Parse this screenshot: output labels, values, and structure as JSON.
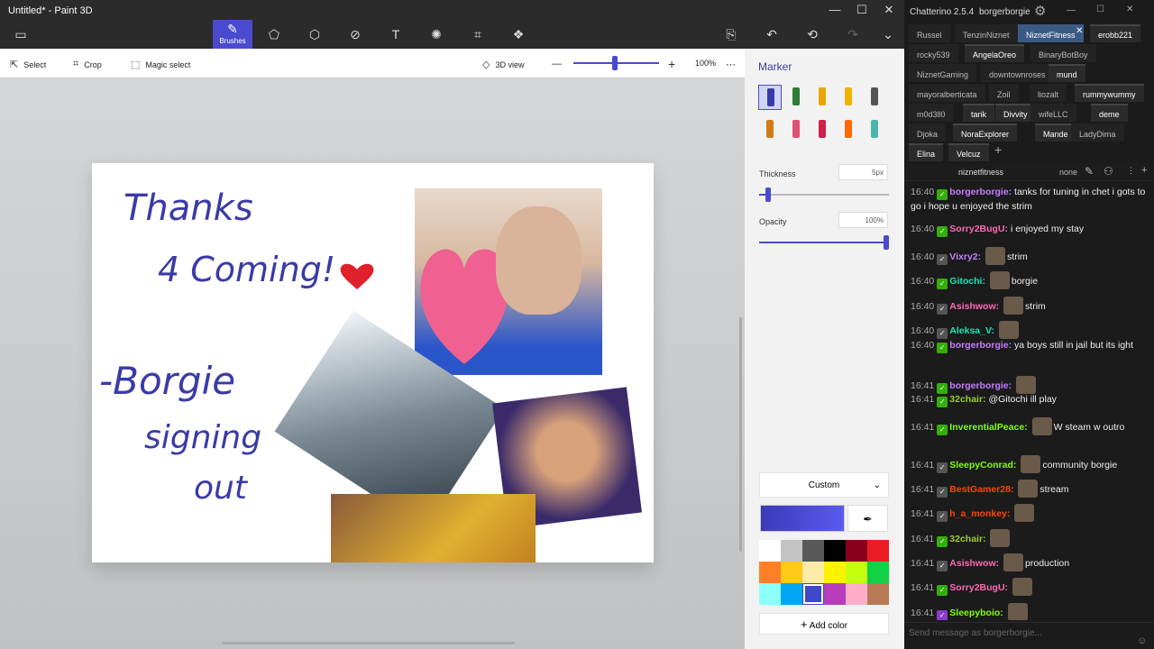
{
  "paint": {
    "title": "Untitled* - Paint 3D",
    "ribbon": {
      "brushes_label": "Brushes"
    },
    "toolbar": {
      "select": "Select",
      "crop": "Crop",
      "magic_select": "Magic select",
      "view3d": "3D view",
      "zoom": "100%"
    },
    "canvas": {
      "line1": "Thanks",
      "line2": "4 Coming!",
      "line3": "-Borgie",
      "line4": "signing",
      "line5": "out"
    },
    "panel": {
      "heading": "Marker",
      "thickness_label": "Thickness",
      "thickness_value": "5px",
      "thickness_level": 0.05,
      "opacity_label": "Opacity",
      "opacity_value": "100%",
      "opacity_level": 1.0,
      "color_mode": "Custom",
      "add_color": "Add color",
      "current_color": "#4444cc",
      "palette": [
        "#ffffff",
        "#c3c3c3",
        "#585858",
        "#000000",
        "#88001b",
        "#ec1c24",
        "#ff7f27",
        "#ffca18",
        "#fdeca6",
        "#fff200",
        "#c4ff0e",
        "#0ed145",
        "#8cfffb",
        "#00a8f3",
        "#3f48cc",
        "#b83dba",
        "#ffaec8",
        "#b97a56"
      ],
      "brush_icons": [
        "marker-icon",
        "calligraphy-pen-icon",
        "oil-brush-icon",
        "watercolor-icon",
        "pixel-pen-icon",
        "pencil-icon",
        "eraser-icon",
        "crayon-icon",
        "spray-can-icon",
        "fill-icon"
      ]
    }
  },
  "chat": {
    "app": "Chatterino 2.5.4",
    "account": "borgerborgie",
    "tabs_row1": [
      "Russel",
      "TenzinNiznet",
      "NiznetFitness",
      "erobb221"
    ],
    "tabs_row2": [
      "rocky539",
      "AngelaOreo",
      "BinaryBotBoy"
    ],
    "tabs_row3": [
      "NiznetGaming",
      "downtownroses",
      "mund"
    ],
    "tabs_row4": [
      "mayoralberticata",
      "Zoil",
      "liozalt",
      "rummywummy"
    ],
    "tabs_row5": [
      "m0d3ll0",
      "tarik",
      "Divvity",
      "wifeLLC",
      "deme"
    ],
    "tabs_row6": [
      "Djoka",
      "NoraExplorer",
      "Mande",
      "LadyDima"
    ],
    "tabs_row7": [
      "Elina",
      "Velcuz"
    ],
    "channel": "niznetfitness",
    "channel_mode": "none",
    "input_placeholder": "Send message as borgerborgie...",
    "messages": [
      {
        "time": "16:40",
        "user": "borgerborgie",
        "color": "#c77cff",
        "text": "tanks for tuning in chet i gots to go i hope u enjoyed the strim"
      },
      {
        "time": "16:40",
        "user": "Sorry2BugU",
        "color": "#ff69b4",
        "text": "i enjoyed my stay"
      },
      {
        "time": "16:40",
        "user": "Vixry2",
        "color": "#c77cff",
        "text": "strim"
      },
      {
        "time": "16:40",
        "user": "Gitochi",
        "color": "#19e6b5",
        "text": "borgie"
      },
      {
        "time": "16:40",
        "user": "Asishwow",
        "color": "#ff69b4",
        "text": "strim"
      },
      {
        "time": "16:40",
        "user": "Aleksa_V",
        "color": "#19e6b5",
        "text": ""
      },
      {
        "time": "16:40",
        "user": "borgerborgie",
        "color": "#c77cff",
        "text": "ya boys still in jail but its ight"
      },
      {
        "time": "16:41",
        "user": "borgerborgie",
        "color": "#c77cff",
        "text": ""
      },
      {
        "time": "16:41",
        "user": "32chair",
        "color": "#9acd32",
        "text": "@Gitochi ill play"
      },
      {
        "time": "16:41",
        "user": "InverentialPeace",
        "color": "#7fff00",
        "text": "W steam w outro"
      },
      {
        "time": "16:41",
        "user": "SleepyConrad",
        "color": "#7fff00",
        "text": "community borgie"
      },
      {
        "time": "16:41",
        "user": "BestGamer28",
        "color": "#ff4500",
        "text": "stream"
      },
      {
        "time": "16:41",
        "user": "h_a_monkey",
        "color": "#ff4500",
        "text": ""
      },
      {
        "time": "16:41",
        "user": "32chair",
        "color": "#9acd32",
        "text": ""
      },
      {
        "time": "16:41",
        "user": "Asishwow",
        "color": "#ff69b4",
        "text": "production"
      },
      {
        "time": "16:41",
        "user": "Sorry2BugU",
        "color": "#ff69b4",
        "text": ""
      },
      {
        "time": "16:41",
        "user": "Sleepyboio",
        "color": "#7fff00",
        "text": ""
      }
    ]
  }
}
